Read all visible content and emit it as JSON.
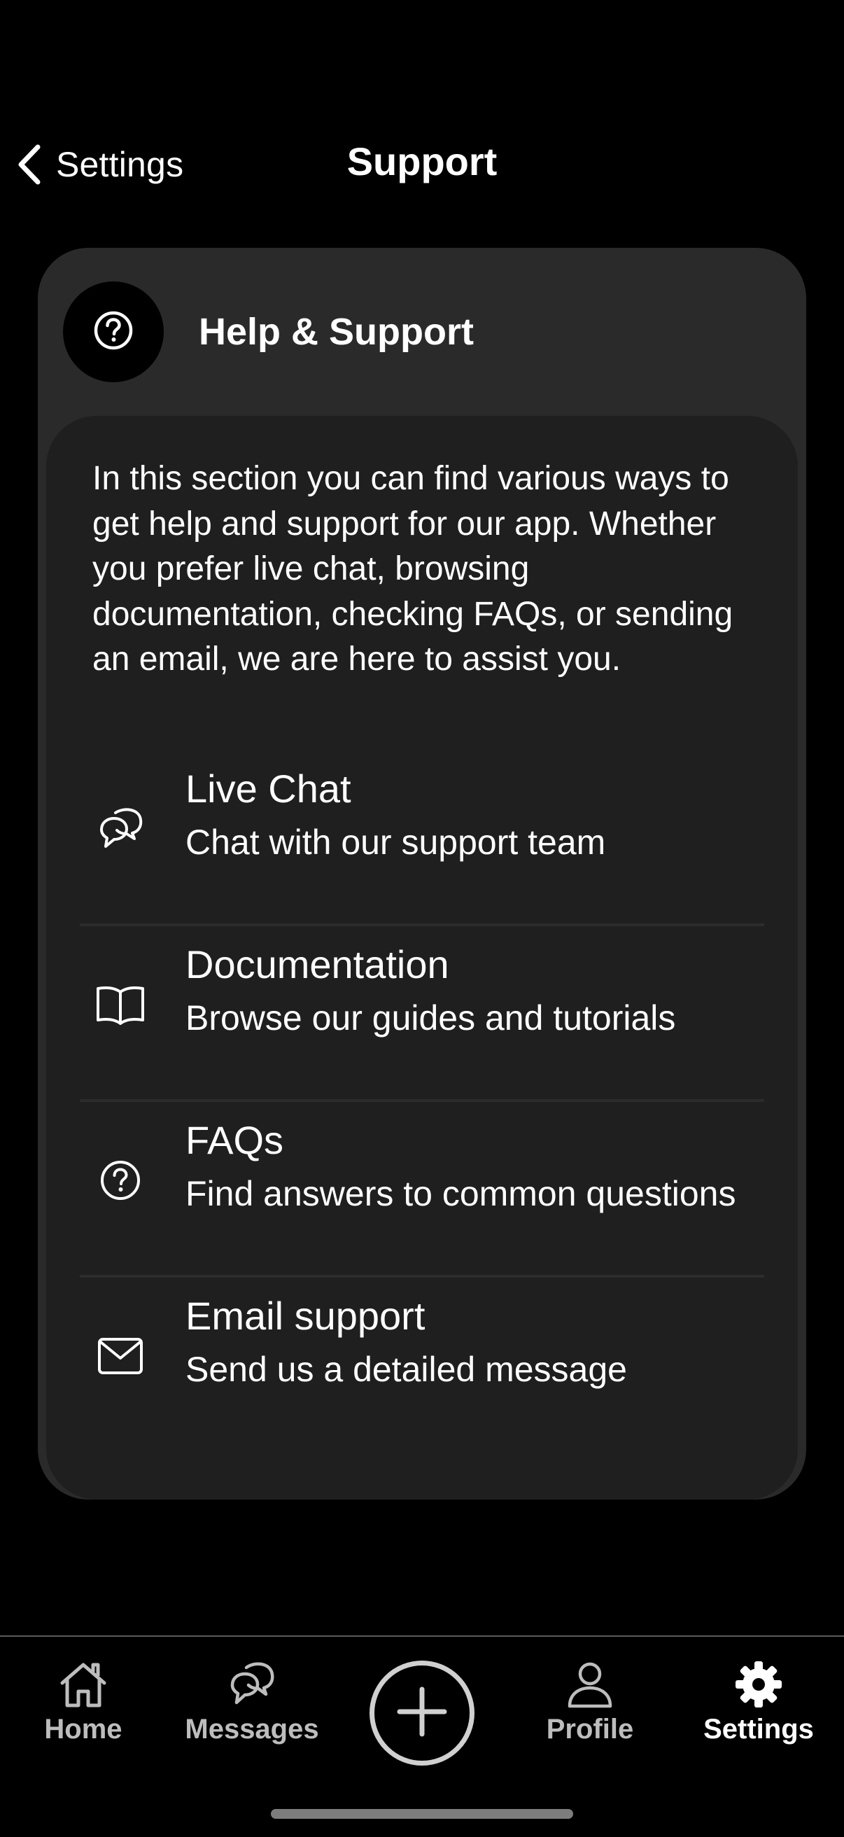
{
  "header": {
    "back_label": "Settings",
    "title": "Support",
    "back_icon": "chevron-left-icon"
  },
  "card": {
    "icon": "question-circle-icon",
    "title": "Help & Support",
    "intro": "In this section you can find various ways to get help and support for our app. Whether you prefer live chat, browsing documentation, checking FAQs, or sending an email, we are here to assist you.",
    "options": [
      {
        "icon": "chat-bubbles-icon",
        "title": "Live Chat",
        "subtitle": "Chat with our support team"
      },
      {
        "icon": "book-icon",
        "title": "Documentation",
        "subtitle": "Browse our guides and tutorials"
      },
      {
        "icon": "question-circle-icon",
        "title": "FAQs",
        "subtitle": "Find answers to common questions"
      },
      {
        "icon": "envelope-icon",
        "title": "Email support",
        "subtitle": "Send us a detailed message"
      }
    ]
  },
  "tab_bar": {
    "tabs": [
      {
        "label": "Home",
        "icon": "home-icon"
      },
      {
        "label": "Messages",
        "icon": "chat-bubbles-icon"
      },
      {
        "label": "",
        "icon": "plus-circle-icon"
      },
      {
        "label": "Profile",
        "icon": "person-icon"
      },
      {
        "label": "Settings",
        "icon": "gear-icon"
      }
    ],
    "active": "Settings"
  },
  "colors": {
    "background": "#000000",
    "outer_card": "#2a2a2a",
    "inner_card": "#1f1f1f",
    "text_primary": "#ffffff",
    "tab_inactive": "#bdbdbd"
  }
}
